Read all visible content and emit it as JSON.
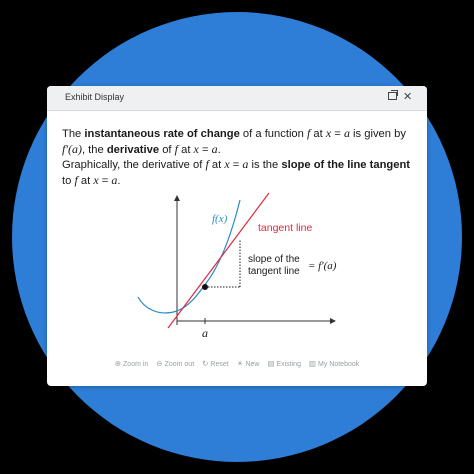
{
  "window": {
    "title": "Exhibit Display"
  },
  "content": {
    "p1_a": "The ",
    "p1_b": "instantaneous rate of change",
    "p1_c": " of a function ",
    "p1_f": "f",
    "p1_d": " at ",
    "p1_x": "x",
    "p1_e": " = ",
    "p1_a2": "a",
    "p1_g": " is given by",
    "p1_line2a": "f′(a)",
    "p1_line2b": ", the ",
    "p1_line2c": "derivative",
    "p1_line2d": " of ",
    "p1_line2e": "f",
    "p1_line2f": " at ",
    "p1_line2g": "x",
    "p1_line2h": " = ",
    "p1_line2i": "a",
    "p1_line2j": ".",
    "p2_a": "Graphically, the derivative of ",
    "p2_f": "f",
    "p2_b": " at ",
    "p2_x": "x",
    "p2_c": " = ",
    "p2_a2": "a",
    "p2_d": " is the ",
    "p2_e": "slope of the line tangent",
    "p2_g": "to ",
    "p2_f2": "f",
    "p2_h": " at ",
    "p2_x2": "x",
    "p2_i": " = ",
    "p2_a3": "a",
    "p2_j": "."
  },
  "figure": {
    "curve_label": "f(x)",
    "tangent_label": "tangent line",
    "slope_label_line1": "slope of the",
    "slope_label_line2": "tangent line",
    "slope_value": "= f′(a)",
    "x_tick_label": "a",
    "colors": {
      "curve": "#2a8ac4",
      "tangent": "#e0283c",
      "axis": "#333333"
    }
  },
  "toolbar": {
    "zoom_in": "Zoom in",
    "zoom_out": "Zoom out",
    "reset": "Reset",
    "new": "New",
    "existing": "Existing",
    "notebook": "My Notebook"
  },
  "icons": {
    "zoom_in": "magnifier-plus-icon",
    "zoom_out": "magnifier-minus-icon",
    "reset": "refresh-icon",
    "new": "lightbulb-icon",
    "existing": "document-icon",
    "notebook": "notebook-icon"
  }
}
